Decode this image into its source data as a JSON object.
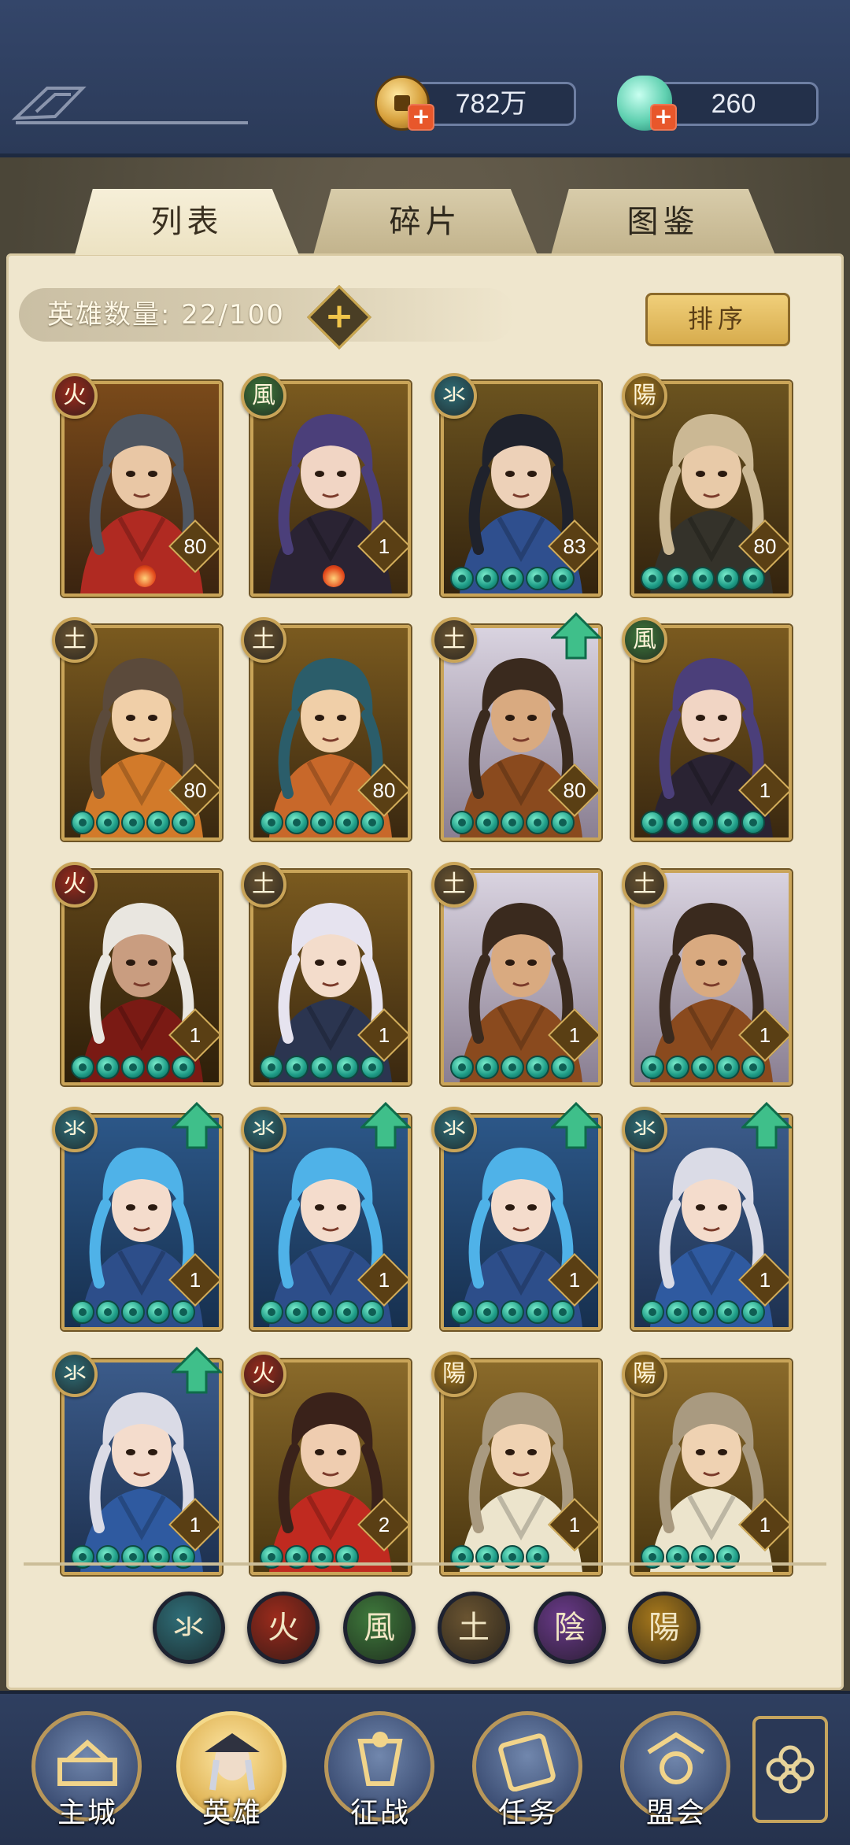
{
  "currency": {
    "coins": "782万",
    "jade": "260"
  },
  "tabs": [
    {
      "label": "列表",
      "active": true
    },
    {
      "label": "碎片",
      "active": false
    },
    {
      "label": "图鉴",
      "active": false
    }
  ],
  "hero_count": {
    "label": "英雄数量: 22/100"
  },
  "sort_button": "排序",
  "elements": {
    "水": {
      "glyph": "氺",
      "color": "#2f6e78"
    },
    "火": {
      "glyph": "火",
      "color": "#9c2b1c"
    },
    "风": {
      "glyph": "風",
      "color": "#3f7a3c"
    },
    "土": {
      "glyph": "土",
      "color": "#6a5431"
    },
    "阴": {
      "glyph": "陰",
      "color": "#6a3a8a"
    },
    "阳": {
      "glyph": "陽",
      "color": "#a97a1c"
    }
  },
  "heroes": [
    {
      "element": "火",
      "level": "80",
      "stars": 0,
      "flame": true,
      "upgrade": false,
      "art": "red"
    },
    {
      "element": "风",
      "level": "1",
      "stars": 0,
      "flame": true,
      "upgrade": false,
      "art": "purple"
    },
    {
      "element": "水",
      "level": "83",
      "stars": 5,
      "flame": false,
      "upgrade": false,
      "art": "blue-dark"
    },
    {
      "element": "阳",
      "level": "80",
      "stars": 5,
      "flame": false,
      "upgrade": false,
      "art": "blond"
    },
    {
      "element": "土",
      "level": "80",
      "stars": 5,
      "flame": false,
      "upgrade": false,
      "art": "brown"
    },
    {
      "element": "土",
      "level": "80",
      "stars": 5,
      "flame": false,
      "upgrade": false,
      "art": "teal-orange"
    },
    {
      "element": "土",
      "level": "80",
      "stars": 5,
      "flame": false,
      "upgrade": true,
      "art": "warlord"
    },
    {
      "element": "风",
      "level": "1",
      "stars": 5,
      "flame": false,
      "upgrade": false,
      "art": "purple"
    },
    {
      "element": "火",
      "level": "1",
      "stars": 5,
      "flame": false,
      "upgrade": false,
      "art": "white-red"
    },
    {
      "element": "土",
      "level": "1",
      "stars": 5,
      "flame": false,
      "upgrade": false,
      "art": "silver"
    },
    {
      "element": "土",
      "level": "1",
      "stars": 5,
      "flame": false,
      "upgrade": false,
      "art": "warlord"
    },
    {
      "element": "土",
      "level": "1",
      "stars": 5,
      "flame": false,
      "upgrade": false,
      "art": "warlord"
    },
    {
      "element": "水",
      "level": "1",
      "stars": 5,
      "flame": false,
      "upgrade": true,
      "art": "cyan"
    },
    {
      "element": "水",
      "level": "1",
      "stars": 5,
      "flame": false,
      "upgrade": true,
      "art": "cyan"
    },
    {
      "element": "水",
      "level": "1",
      "stars": 5,
      "flame": false,
      "upgrade": true,
      "art": "cyan"
    },
    {
      "element": "水",
      "level": "1",
      "stars": 5,
      "flame": false,
      "upgrade": true,
      "art": "silver-blue"
    },
    {
      "element": "水",
      "level": "1",
      "stars": 5,
      "flame": false,
      "upgrade": true,
      "art": "silver-blue"
    },
    {
      "element": "火",
      "level": "2",
      "stars": 4,
      "flame": false,
      "upgrade": false,
      "art": "red-warrior"
    },
    {
      "element": "阳",
      "level": "1",
      "stars": 4,
      "flame": false,
      "upgrade": false,
      "art": "cream"
    },
    {
      "element": "阳",
      "level": "1",
      "stars": 4,
      "flame": false,
      "upgrade": false,
      "art": "cream"
    }
  ],
  "element_filters": [
    "水",
    "火",
    "风",
    "土",
    "阴",
    "阳"
  ],
  "nav": [
    {
      "label": "主城",
      "icon": "castle-icon",
      "active": false
    },
    {
      "label": "英雄",
      "icon": "hero-portrait-icon",
      "active": true
    },
    {
      "label": "征战",
      "icon": "battle-icon",
      "active": false
    },
    {
      "label": "任务",
      "icon": "scroll-icon",
      "active": false
    },
    {
      "label": "盟会",
      "icon": "alliance-icon",
      "active": false
    }
  ]
}
